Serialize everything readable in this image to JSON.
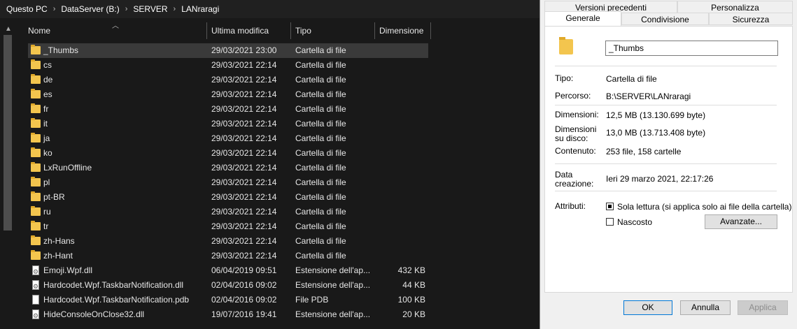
{
  "breadcrumb": [
    "Questo PC",
    "DataServer (B:)",
    "SERVER",
    "LANraragi"
  ],
  "columns": {
    "name": "Nome",
    "date": "Ultima modifica",
    "type": "Tipo",
    "size": "Dimensione"
  },
  "files": [
    {
      "name": "_Thumbs",
      "date": "29/03/2021 23:00",
      "type": "Cartella di file",
      "size": "",
      "icon": "folder",
      "selected": true
    },
    {
      "name": "cs",
      "date": "29/03/2021 22:14",
      "type": "Cartella di file",
      "size": "",
      "icon": "folder"
    },
    {
      "name": "de",
      "date": "29/03/2021 22:14",
      "type": "Cartella di file",
      "size": "",
      "icon": "folder"
    },
    {
      "name": "es",
      "date": "29/03/2021 22:14",
      "type": "Cartella di file",
      "size": "",
      "icon": "folder"
    },
    {
      "name": "fr",
      "date": "29/03/2021 22:14",
      "type": "Cartella di file",
      "size": "",
      "icon": "folder"
    },
    {
      "name": "it",
      "date": "29/03/2021 22:14",
      "type": "Cartella di file",
      "size": "",
      "icon": "folder"
    },
    {
      "name": "ja",
      "date": "29/03/2021 22:14",
      "type": "Cartella di file",
      "size": "",
      "icon": "folder"
    },
    {
      "name": "ko",
      "date": "29/03/2021 22:14",
      "type": "Cartella di file",
      "size": "",
      "icon": "folder"
    },
    {
      "name": "LxRunOffline",
      "date": "29/03/2021 22:14",
      "type": "Cartella di file",
      "size": "",
      "icon": "folder"
    },
    {
      "name": "pl",
      "date": "29/03/2021 22:14",
      "type": "Cartella di file",
      "size": "",
      "icon": "folder"
    },
    {
      "name": "pt-BR",
      "date": "29/03/2021 22:14",
      "type": "Cartella di file",
      "size": "",
      "icon": "folder"
    },
    {
      "name": "ru",
      "date": "29/03/2021 22:14",
      "type": "Cartella di file",
      "size": "",
      "icon": "folder"
    },
    {
      "name": "tr",
      "date": "29/03/2021 22:14",
      "type": "Cartella di file",
      "size": "",
      "icon": "folder"
    },
    {
      "name": "zh-Hans",
      "date": "29/03/2021 22:14",
      "type": "Cartella di file",
      "size": "",
      "icon": "folder"
    },
    {
      "name": "zh-Hant",
      "date": "29/03/2021 22:14",
      "type": "Cartella di file",
      "size": "",
      "icon": "folder"
    },
    {
      "name": "Emoji.Wpf.dll",
      "date": "06/04/2019 09:51",
      "type": "Estensione dell'ap...",
      "size": "432 KB",
      "icon": "dll"
    },
    {
      "name": "Hardcodet.Wpf.TaskbarNotification.dll",
      "date": "02/04/2016 09:02",
      "type": "Estensione dell'ap...",
      "size": "44 KB",
      "icon": "dll"
    },
    {
      "name": "Hardcodet.Wpf.TaskbarNotification.pdb",
      "date": "02/04/2016 09:02",
      "type": "File PDB",
      "size": "100 KB",
      "icon": "file"
    },
    {
      "name": "HideConsoleOnClose32.dll",
      "date": "19/07/2016 19:41",
      "type": "Estensione dell'ap...",
      "size": "20 KB",
      "icon": "dll"
    }
  ],
  "dialog": {
    "tabs_back": [
      "Versioni precedenti",
      "Personalizza"
    ],
    "tabs_front": [
      "Generale",
      "Condivisione",
      "Sicurezza"
    ],
    "name_value": "_Thumbs",
    "type_label": "Tipo:",
    "type_value": "Cartella di file",
    "path_label": "Percorso:",
    "path_value": "B:\\SERVER\\LANraragi",
    "size_label": "Dimensioni:",
    "size_value": "12,5 MB (13.130.699 byte)",
    "disk_label_1": "Dimensioni",
    "disk_label_2": "su disco:",
    "disk_value": "13,0 MB (13.713.408 byte)",
    "content_label": "Contenuto:",
    "content_value": "253 file, 158 cartelle",
    "created_label_1": "Data",
    "created_label_2": "creazione:",
    "created_value": "Ieri 29 marzo 2021, 22:17:26",
    "attributes_label": "Attributi:",
    "readonly_label": "Sola lettura (si applica solo ai file della cartella)",
    "hidden_label": "Nascosto",
    "advanced_button": "Avanzate...",
    "ok_button": "OK",
    "cancel_button": "Annulla",
    "apply_button": "Applica"
  }
}
